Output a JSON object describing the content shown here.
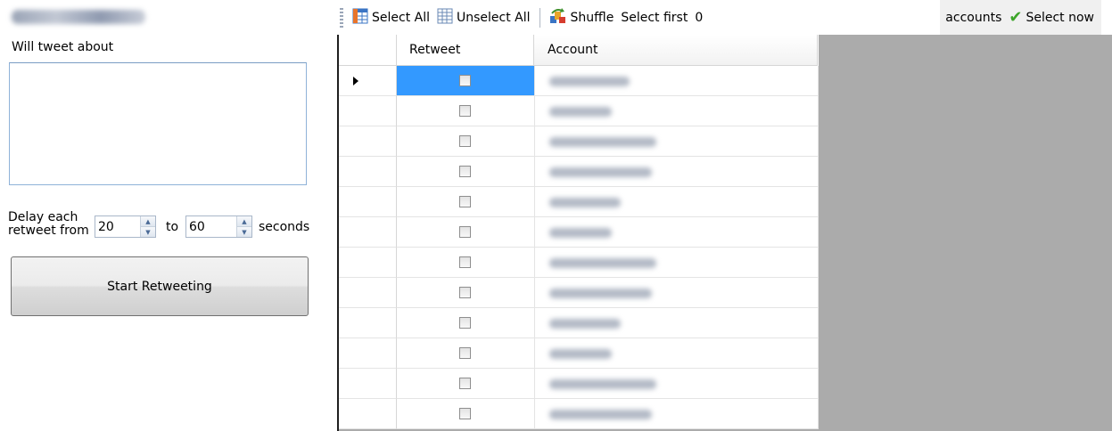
{
  "left_panel": {
    "tweet_label": "Will tweet about",
    "tweet_value": "",
    "delay_label_line1": "Delay each",
    "delay_label_line2": "retweet from",
    "delay_from": "20",
    "to_label": "to",
    "delay_to": "60",
    "seconds_label": "seconds",
    "start_button": "Start Retweeting"
  },
  "toolbar": {
    "select_all": "Select All",
    "unselect_all": "Unselect All",
    "shuffle": "Shuffle",
    "select_first_label": "Select first",
    "select_first_value": "0",
    "accounts_label": "accounts",
    "select_now": "Select now",
    "icons": [
      "select-all-grid-icon",
      "unselect-all-grid-icon",
      "shuffle-icon",
      "checkmark-icon"
    ]
  },
  "grid": {
    "columns": [
      "Retweet",
      "Account"
    ],
    "row_count": 12,
    "selected_row": 0,
    "retweet_checked": [
      false,
      false,
      false,
      false,
      false,
      false,
      false,
      false,
      false,
      false,
      false,
      false
    ]
  },
  "colors": {
    "selection": "#3399ff",
    "grid_background": "#ababab",
    "check_green": "#3da52a"
  }
}
